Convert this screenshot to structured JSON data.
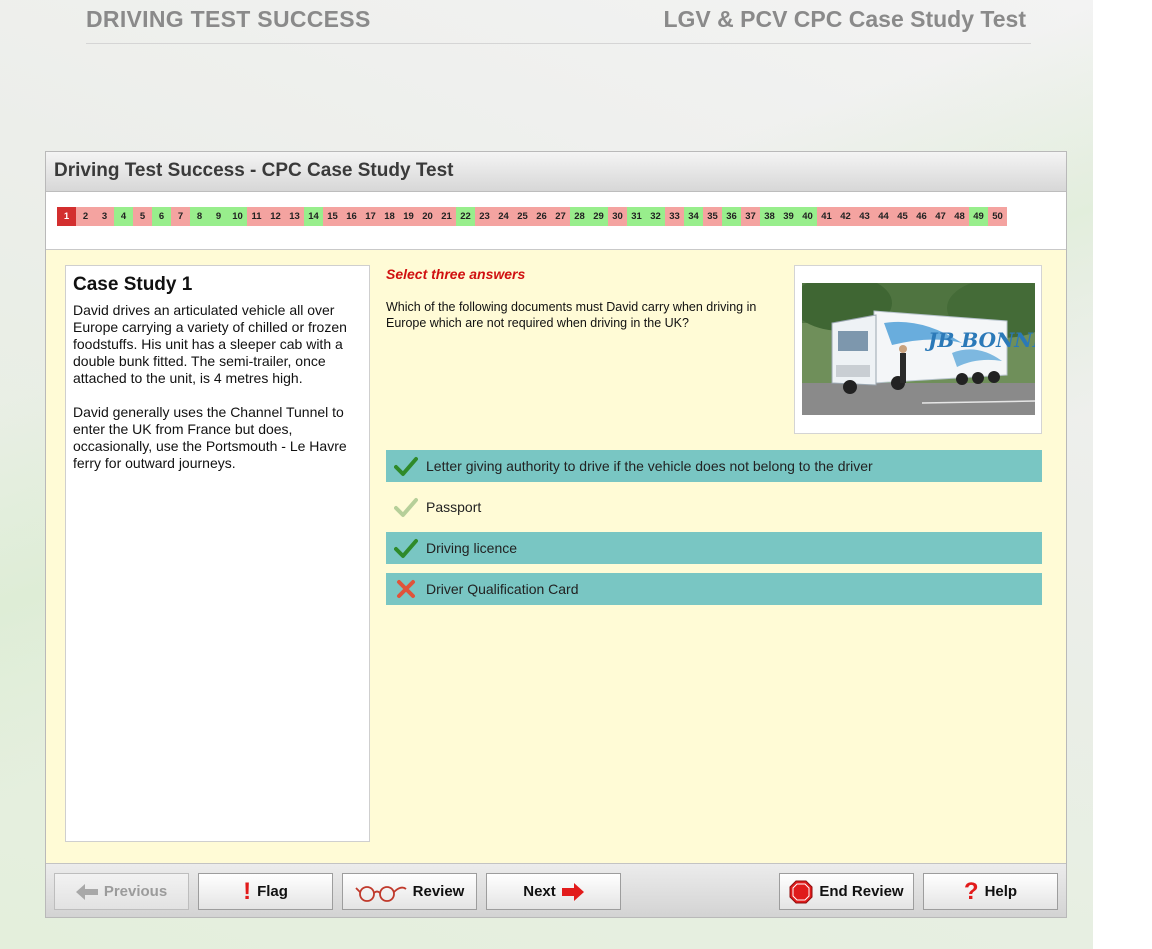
{
  "header": {
    "brand": "DRIVING TEST SUCCESS",
    "title": "LGV & PCV CPC Case Study Test"
  },
  "panel": {
    "title": "Driving Test Success - CPC Case Study Test"
  },
  "question_nav": {
    "current": 1,
    "items": [
      {
        "n": "1",
        "s": "current"
      },
      {
        "n": "2",
        "s": "incorrect"
      },
      {
        "n": "3",
        "s": "incorrect"
      },
      {
        "n": "4",
        "s": "correct"
      },
      {
        "n": "5",
        "s": "incorrect"
      },
      {
        "n": "6",
        "s": "correct"
      },
      {
        "n": "7",
        "s": "incorrect"
      },
      {
        "n": "8",
        "s": "correct"
      },
      {
        "n": "9",
        "s": "correct"
      },
      {
        "n": "10",
        "s": "correct"
      },
      {
        "n": "11",
        "s": "incorrect"
      },
      {
        "n": "12",
        "s": "incorrect"
      },
      {
        "n": "13",
        "s": "incorrect"
      },
      {
        "n": "14",
        "s": "correct"
      },
      {
        "n": "15",
        "s": "incorrect"
      },
      {
        "n": "16",
        "s": "incorrect"
      },
      {
        "n": "17",
        "s": "incorrect"
      },
      {
        "n": "18",
        "s": "incorrect"
      },
      {
        "n": "19",
        "s": "incorrect"
      },
      {
        "n": "20",
        "s": "incorrect"
      },
      {
        "n": "21",
        "s": "incorrect"
      },
      {
        "n": "22",
        "s": "correct"
      },
      {
        "n": "23",
        "s": "incorrect"
      },
      {
        "n": "24",
        "s": "incorrect"
      },
      {
        "n": "25",
        "s": "incorrect"
      },
      {
        "n": "26",
        "s": "incorrect"
      },
      {
        "n": "27",
        "s": "incorrect"
      },
      {
        "n": "28",
        "s": "correct"
      },
      {
        "n": "29",
        "s": "correct"
      },
      {
        "n": "30",
        "s": "incorrect"
      },
      {
        "n": "31",
        "s": "correct"
      },
      {
        "n": "32",
        "s": "correct"
      },
      {
        "n": "33",
        "s": "incorrect"
      },
      {
        "n": "34",
        "s": "correct"
      },
      {
        "n": "35",
        "s": "incorrect"
      },
      {
        "n": "36",
        "s": "correct"
      },
      {
        "n": "37",
        "s": "incorrect"
      },
      {
        "n": "38",
        "s": "correct"
      },
      {
        "n": "39",
        "s": "correct"
      },
      {
        "n": "40",
        "s": "correct"
      },
      {
        "n": "41",
        "s": "incorrect"
      },
      {
        "n": "42",
        "s": "incorrect"
      },
      {
        "n": "43",
        "s": "incorrect"
      },
      {
        "n": "44",
        "s": "incorrect"
      },
      {
        "n": "45",
        "s": "incorrect"
      },
      {
        "n": "46",
        "s": "incorrect"
      },
      {
        "n": "47",
        "s": "incorrect"
      },
      {
        "n": "48",
        "s": "incorrect"
      },
      {
        "n": "49",
        "s": "correct"
      },
      {
        "n": "50",
        "s": "incorrect"
      }
    ]
  },
  "case_study": {
    "title": "Case Study 1",
    "paragraphs": [
      "David drives an articulated vehicle all over Europe carrying a variety of chilled or frozen foodstuffs. His unit has a sleeper cab with a double bunk fitted. The semi-trailer, once attached to the unit, is 4 metres high.",
      "David generally uses the Channel Tunnel to enter the UK from France but does, occasionally, use the Portsmouth - Le Havre ferry for outward journeys."
    ]
  },
  "question": {
    "instruction": "Select three answers",
    "text": "Which of the following documents must David carry when driving in Europe which are not required when driving in the UK?",
    "image_icon": "truck-photo",
    "image_text": "JB BONNET",
    "answers": [
      {
        "label": "Letter giving authority to drive if the vehicle does not belong to the driver",
        "selected": true,
        "mark": "check-icon"
      },
      {
        "label": "Passport",
        "selected": false,
        "mark": "check-faded-icon"
      },
      {
        "label": "Driving licence",
        "selected": true,
        "mark": "check-icon"
      },
      {
        "label": "Driver Qualification Card",
        "selected": true,
        "mark": "cross-icon"
      }
    ]
  },
  "footer": {
    "previous": "Previous",
    "flag": "Flag",
    "review": "Review",
    "next": "Next",
    "end_review": "End Review",
    "help": "Help"
  },
  "colors": {
    "panel_bg": "#fffbd6",
    "selected_answer": "#79c6c3",
    "correct": "#98ee8c",
    "incorrect": "#f4a3a0",
    "current": "#d32f2f",
    "instruction": "#d01010"
  }
}
